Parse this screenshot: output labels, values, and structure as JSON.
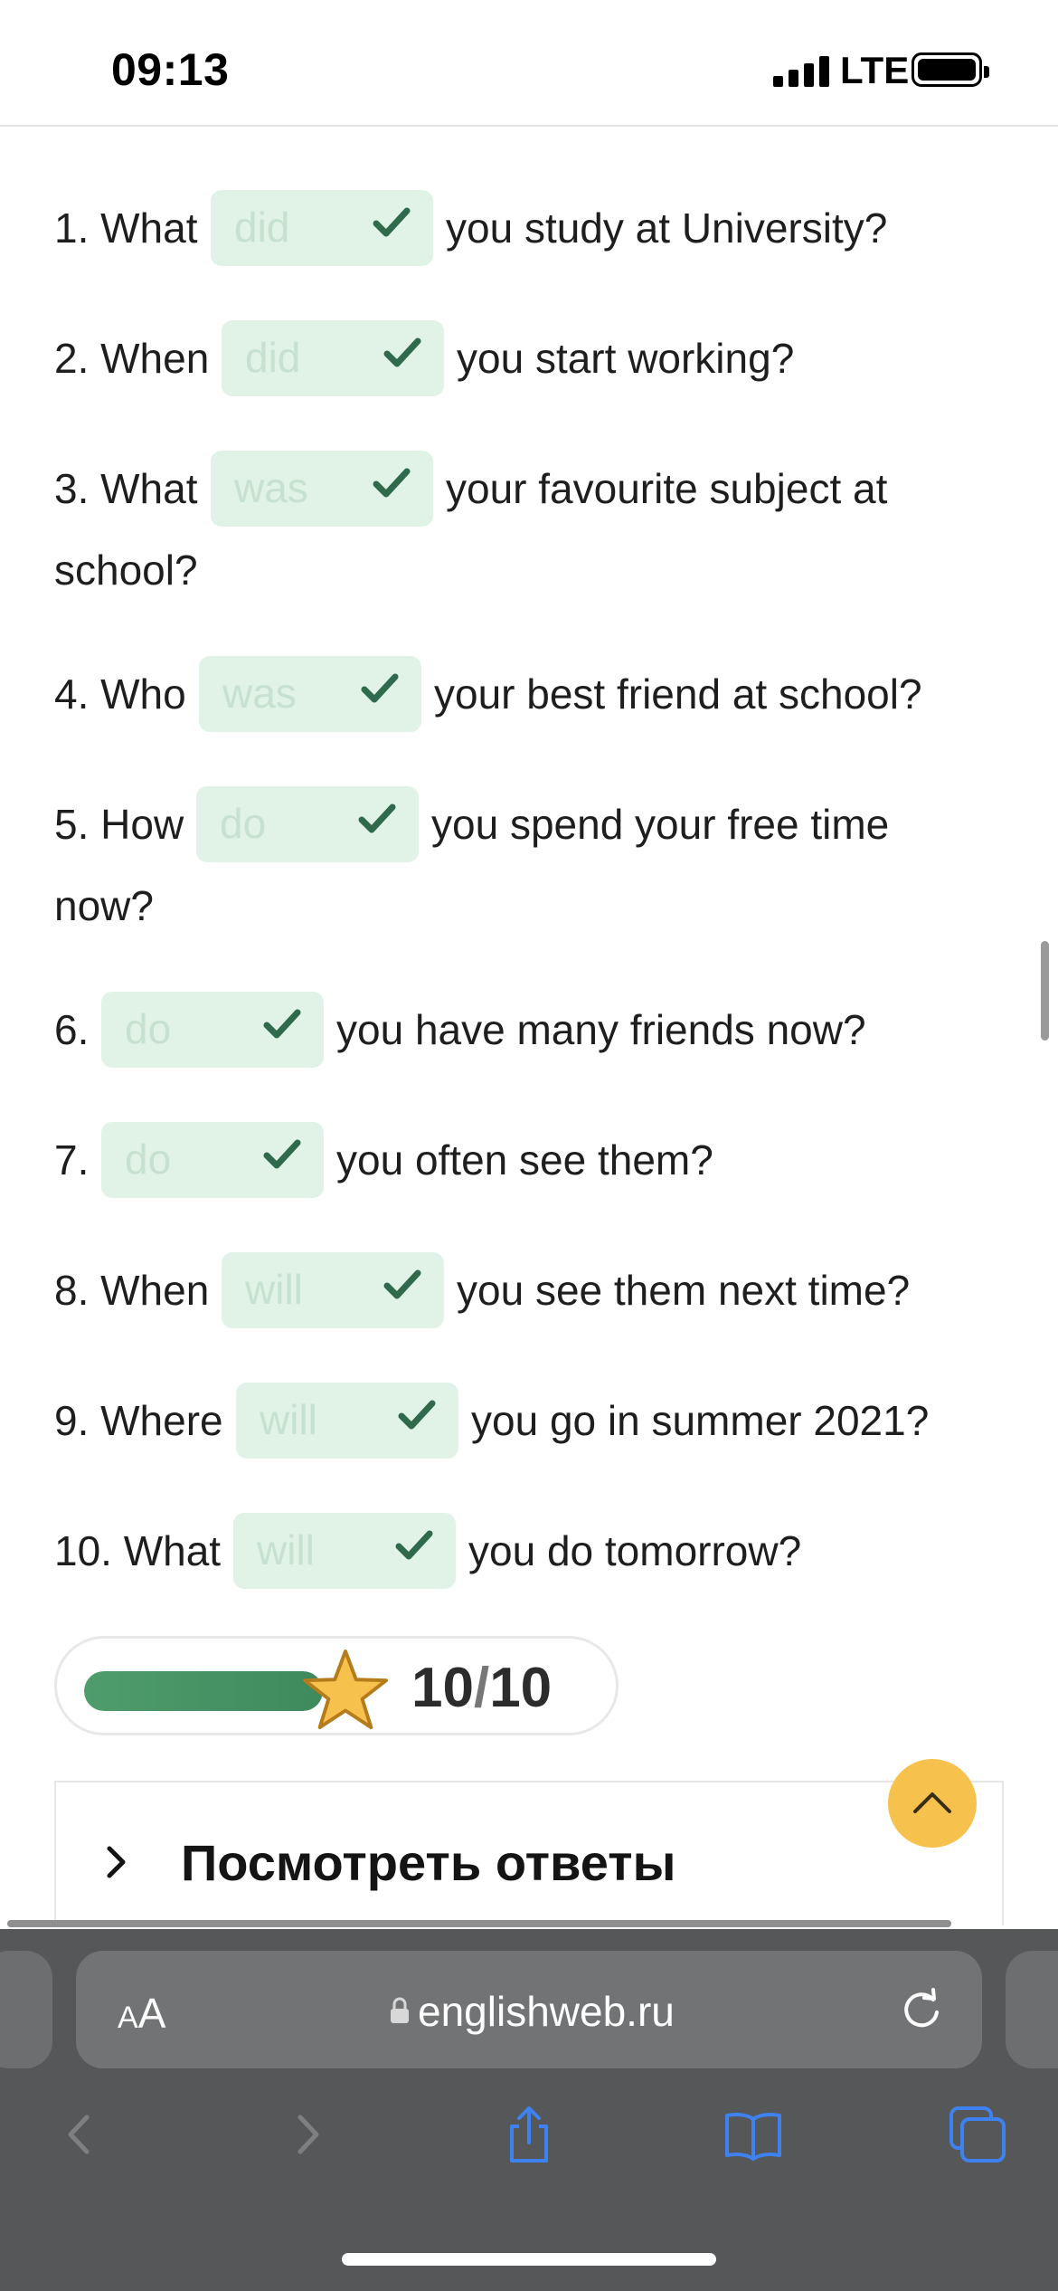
{
  "status_bar": {
    "time": "09:13",
    "network": "LTE"
  },
  "questions": [
    {
      "prefix": "1. What",
      "answer": "did",
      "suffix": "you study at University?",
      "continuation": ""
    },
    {
      "prefix": "2. When",
      "answer": "did",
      "suffix": "you start working?",
      "continuation": ""
    },
    {
      "prefix": "3. What",
      "answer": "was",
      "suffix": "your favourite subject at",
      "continuation": "school?"
    },
    {
      "prefix": "4. Who",
      "answer": "was",
      "suffix": "your best friend at school?",
      "continuation": ""
    },
    {
      "prefix": "5. How",
      "answer": "do",
      "suffix": "you spend your free time",
      "continuation": "now?"
    },
    {
      "prefix": "6.",
      "answer": "do",
      "suffix": "you have many friends now?",
      "continuation": ""
    },
    {
      "prefix": "7.",
      "answer": "do",
      "suffix": "you often see them?",
      "continuation": ""
    },
    {
      "prefix": "8. When",
      "answer": "will",
      "suffix": "you see them next time?",
      "continuation": ""
    },
    {
      "prefix": "9. Where",
      "answer": "will",
      "suffix": "you go in summer 2021?",
      "continuation": ""
    },
    {
      "prefix": "10. What",
      "answer": "will",
      "suffix": "you do tomorrow?",
      "continuation": ""
    }
  ],
  "score": {
    "correct": "10",
    "separator": "/",
    "total": "10",
    "progress_fraction": 1.0
  },
  "answers_panel": {
    "title": "Посмотреть ответы"
  },
  "browser": {
    "aa_small": "A",
    "aa_big": "A",
    "url": "englishweb.ru"
  },
  "icons": {
    "check": "check-icon",
    "star": "star-icon",
    "chevron": "chevron-right-icon",
    "scroll_top": "chevron-up-icon",
    "lock": "lock-icon",
    "reload": "reload-icon",
    "back": "back-icon",
    "forward": "forward-icon",
    "share": "share-icon",
    "bookmarks": "bookmarks-icon",
    "tabs": "tabs-icon"
  },
  "colors": {
    "accent_green": "#3f8a5d",
    "gap_bg": "#e1f2e6",
    "star": "#f6c24d",
    "browser_chrome": "#555759",
    "safari_blue": "#3d82f0"
  }
}
